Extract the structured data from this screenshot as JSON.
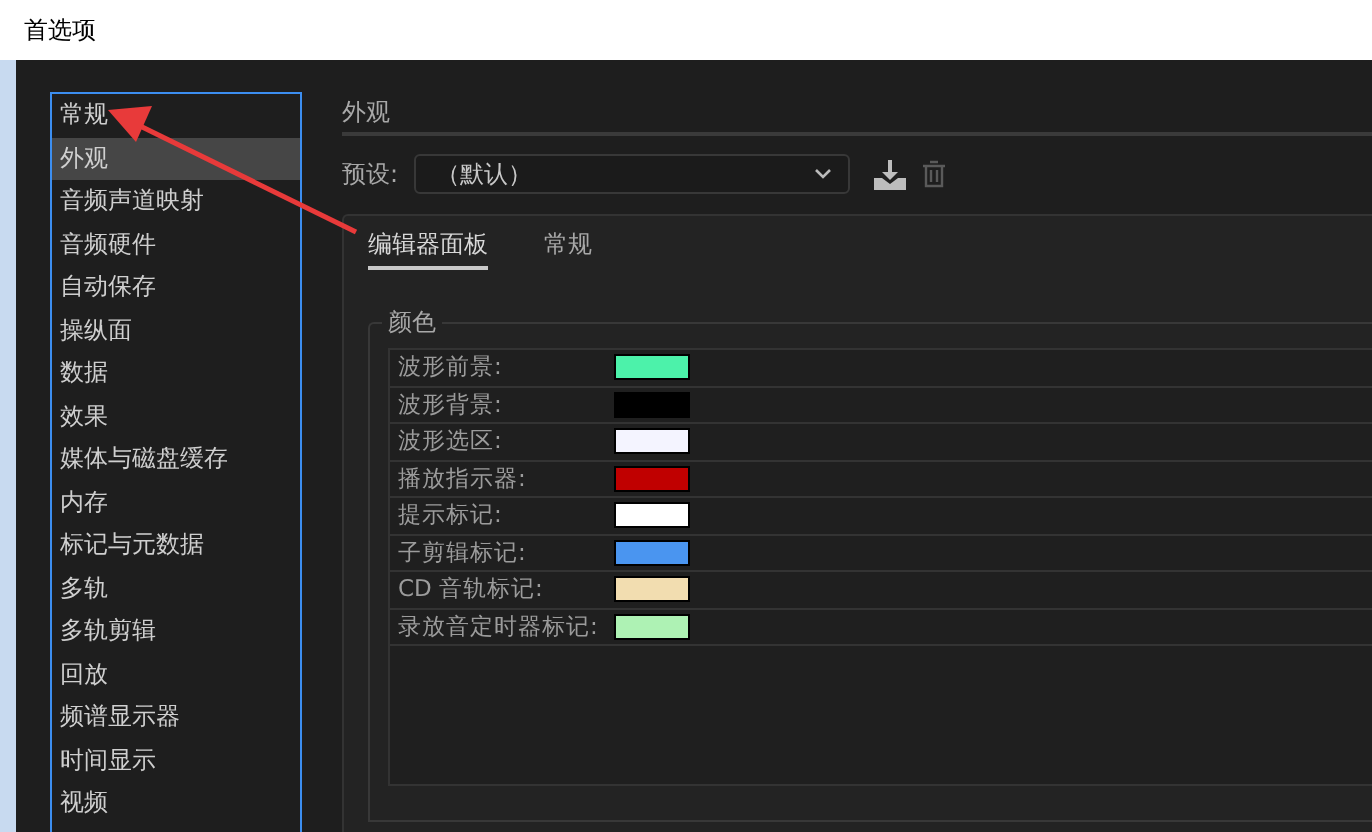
{
  "window": {
    "title": "首选项"
  },
  "sidebar": {
    "items": [
      {
        "label": "常规",
        "selected": false
      },
      {
        "label": "外观",
        "selected": true
      },
      {
        "label": "音频声道映射",
        "selected": false
      },
      {
        "label": "音频硬件",
        "selected": false
      },
      {
        "label": "自动保存",
        "selected": false
      },
      {
        "label": "操纵面",
        "selected": false
      },
      {
        "label": "数据",
        "selected": false
      },
      {
        "label": "效果",
        "selected": false
      },
      {
        "label": "媒体与磁盘缓存",
        "selected": false
      },
      {
        "label": "内存",
        "selected": false
      },
      {
        "label": "标记与元数据",
        "selected": false
      },
      {
        "label": "多轨",
        "selected": false
      },
      {
        "label": "多轨剪辑",
        "selected": false
      },
      {
        "label": "回放",
        "selected": false
      },
      {
        "label": "频谱显示器",
        "selected": false
      },
      {
        "label": "时间显示",
        "selected": false
      },
      {
        "label": "视频",
        "selected": false
      }
    ]
  },
  "section_title": "外观",
  "preset": {
    "label": "预设:",
    "value": "（默认）"
  },
  "tabs": [
    {
      "label": "编辑器面板",
      "selected": true
    },
    {
      "label": "常规",
      "selected": false
    }
  ],
  "colors": {
    "title": "颜色",
    "rows": [
      {
        "label": "波形前景:",
        "color": "#4cf2aa"
      },
      {
        "label": "波形背景:",
        "color": "#000000"
      },
      {
        "label": "波形选区:",
        "color": "#f4f4ff"
      },
      {
        "label": "播放指示器:",
        "color": "#c00000"
      },
      {
        "label": "提示标记:",
        "color": "#ffffff"
      },
      {
        "label": "子剪辑标记:",
        "color": "#4a95f0"
      },
      {
        "label": "CD 音轨标记:",
        "color": "#f2ddb0"
      },
      {
        "label": "录放音定时器标记:",
        "color": "#aef2b4"
      }
    ]
  }
}
